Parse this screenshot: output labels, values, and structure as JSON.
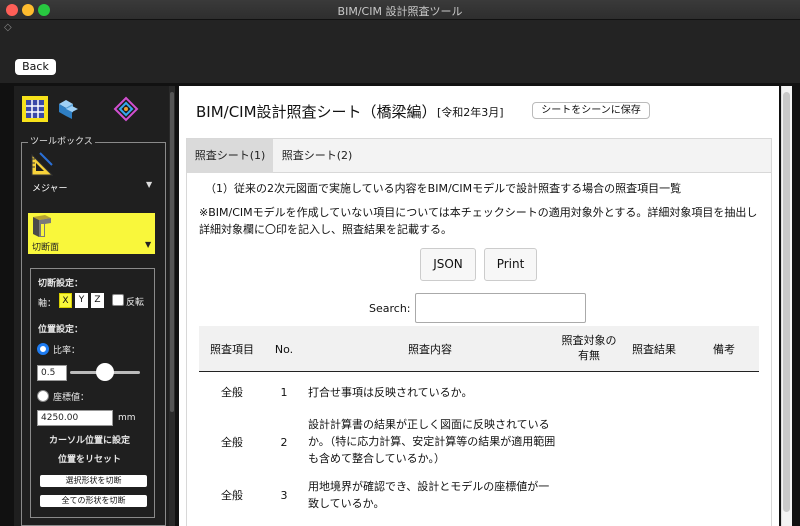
{
  "window": {
    "title": "BIM/CIM 設計照査ツール"
  },
  "nav": {
    "back_label": "Back"
  },
  "sidebar": {
    "toolbox_label": "ツールボックス",
    "tool1_label": "メジャー",
    "tool2_label": "切断面",
    "cut_settings_label": "切断設定：",
    "axis_label": "軸：",
    "axis_x": "X",
    "axis_y": "Y",
    "axis_z": "Z",
    "invert_label": "反転",
    "position_label": "位置設定：",
    "ratio_label": "比率：",
    "ratio_value": "0.5",
    "ratio_slider": 0.5,
    "coord_label": "座標値：",
    "coord_value": "4250.00",
    "coord_unit": "mm",
    "set_cursor_label": "カーソル位置に設定",
    "reset_position_label": "位置をリセット",
    "cut_selected_label": "選択形状を切断",
    "cut_all_label": "全ての形状を切断"
  },
  "main": {
    "sheet_title": "BIM/CIM設計照査シート（橋梁編）",
    "sheet_date": "[令和2年3月]",
    "save_button": "シートをシーンに保存",
    "tabs": [
      {
        "label": "照査シート(1)"
      },
      {
        "label": "照査シート(2)"
      }
    ],
    "heading": "（1）従来の2次元図面で実施している内容をBIM/CIMモデルで設計照査する場合の照査項目一覧",
    "note": "※BIM/CIMモデルを作成していない項目については本チェックシートの適用対象外とする。詳細対象項目を抽出し詳細対象欄に〇印を記入し、照査結果を記載する。",
    "json_button": "JSON",
    "print_button": "Print",
    "search_label": "Search:",
    "search_value": "",
    "columns": [
      "照査項目",
      "No.",
      "照査内容",
      "照査対象の有無",
      "照査結果",
      "備考"
    ],
    "rows": [
      {
        "item": "全般",
        "no": "1",
        "content": "打合せ事項は反映されているか。"
      },
      {
        "item": "全般",
        "no": "2",
        "content": "設計計算書の結果が正しく図面に反映されているか。（特に応力計算、安定計算等の結果が適用範囲も含めて整合しているか。）"
      },
      {
        "item": "全般",
        "no": "3",
        "content": "用地境界が確認でき、設計とモデルの座標値が一致しているか。"
      }
    ]
  },
  "colors": {
    "accent": "#f9f73b",
    "radio": "#1e7cf2"
  }
}
